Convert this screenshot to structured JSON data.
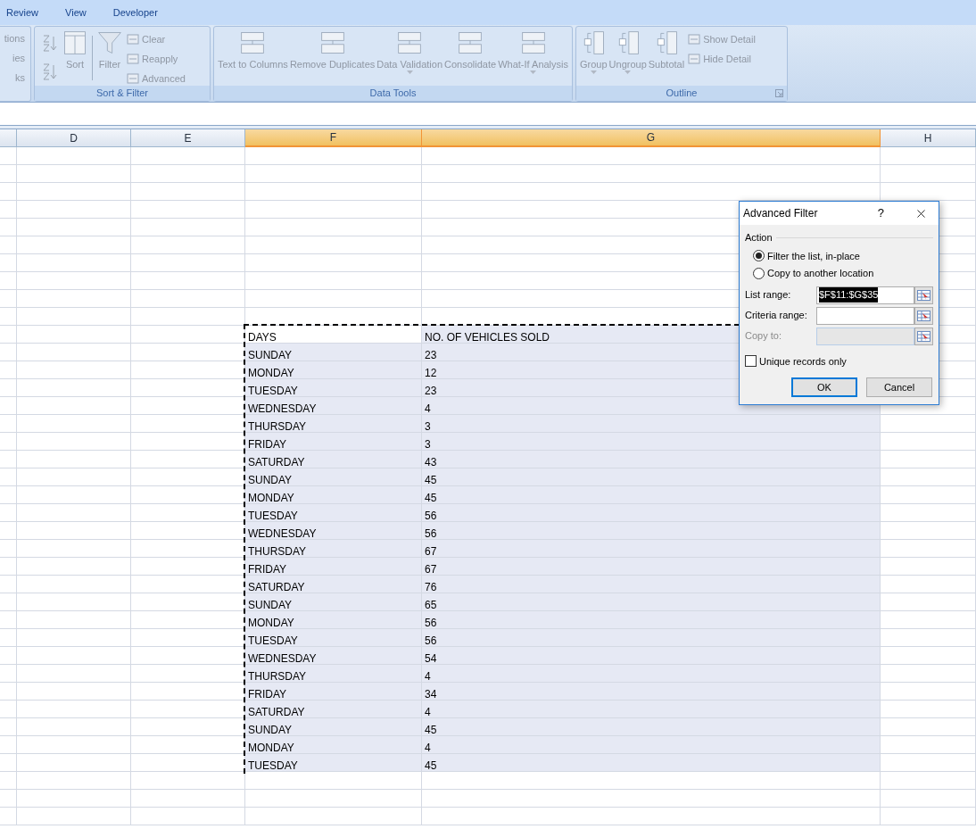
{
  "ribbon_tabs": [
    {
      "label": "Review"
    },
    {
      "label": "View"
    },
    {
      "label": "Developer"
    }
  ],
  "ribbon_groups": [
    {
      "kind": "partial",
      "buttons": [
        {
          "kind": "small",
          "label": "tions",
          "disabled": true
        },
        {
          "kind": "small",
          "label": "ies",
          "disabled": true
        },
        {
          "kind": "small",
          "label": "ks",
          "disabled": true
        }
      ]
    },
    {
      "kind": "sort_filter",
      "title": "Sort & Filter",
      "buttons": [
        {
          "kind": "sort_pair",
          "disabled": true
        },
        {
          "kind": "large",
          "label": "Sort",
          "disabled": true
        },
        {
          "kind": "large",
          "label": "Filter",
          "disabled": true
        },
        {
          "kind": "small_stack",
          "items": [
            {
              "label": "Clear",
              "disabled": true
            },
            {
              "label": "Reapply",
              "disabled": true
            },
            {
              "label": "Advanced",
              "disabled": true
            }
          ]
        }
      ]
    },
    {
      "kind": "data_tools",
      "title": "Data Tools",
      "buttons": [
        {
          "kind": "large",
          "label": "Text to Columns",
          "disabled": true
        },
        {
          "kind": "large",
          "label": "Remove Duplicates",
          "disabled": true
        },
        {
          "kind": "large",
          "label": "Data Validation",
          "dropdown": true,
          "disabled": true
        },
        {
          "kind": "large",
          "label": "Consolidate",
          "disabled": true
        },
        {
          "kind": "large",
          "label": "What-If Analysis",
          "dropdown": true,
          "disabled": true
        }
      ]
    },
    {
      "kind": "outline",
      "title": "Outline",
      "launcher": true,
      "buttons": [
        {
          "kind": "large",
          "label": "Group",
          "dropdown": true,
          "disabled": true
        },
        {
          "kind": "large",
          "label": "Ungroup",
          "dropdown": true,
          "disabled": true
        },
        {
          "kind": "large",
          "label": "Subtotal",
          "disabled": true
        },
        {
          "kind": "small_stack",
          "items": [
            {
              "label": "Show Detail",
              "disabled": true
            },
            {
              "label": "Hide Detail",
              "disabled": true
            }
          ]
        }
      ]
    }
  ],
  "columns": [
    {
      "selected": false
    },
    {
      "label": "D",
      "selected": false
    },
    {
      "label": "E",
      "selected": false
    },
    {
      "label": "F",
      "selected": true
    },
    {
      "label": "G",
      "selected": true
    },
    {
      "label": "H",
      "selected": false
    }
  ],
  "table": {
    "header": [
      "DAYS",
      "NO. OF VEHICLES SOLD"
    ],
    "range_selected": true,
    "rows": [
      [
        "SUNDAY",
        "23"
      ],
      [
        "MONDAY",
        "12"
      ],
      [
        "TUESDAY",
        "23"
      ],
      [
        "WEDNESDAY",
        "4"
      ],
      [
        "THURSDAY",
        "3"
      ],
      [
        "FRIDAY",
        "3"
      ],
      [
        "SATURDAY",
        "43"
      ],
      [
        "SUNDAY",
        "45"
      ],
      [
        "MONDAY",
        "45"
      ],
      [
        "TUESDAY",
        "56"
      ],
      [
        "WEDNESDAY",
        "56"
      ],
      [
        "THURSDAY",
        "67"
      ],
      [
        "FRIDAY",
        "67"
      ],
      [
        "SATURDAY",
        "76"
      ],
      [
        "SUNDAY",
        "65"
      ],
      [
        "MONDAY",
        "56"
      ],
      [
        "TUESDAY",
        "56"
      ],
      [
        "WEDNESDAY",
        "54"
      ],
      [
        "THURSDAY",
        "4"
      ],
      [
        "FRIDAY",
        "34"
      ],
      [
        "SATURDAY",
        "4"
      ],
      [
        "SUNDAY",
        "45"
      ],
      [
        "MONDAY",
        "4"
      ],
      [
        "TUESDAY",
        "45"
      ]
    ]
  },
  "dialog": {
    "title": "Advanced Filter",
    "help": "?",
    "section": "Action",
    "options": [
      {
        "label": "Filter the list, in-place",
        "selected": true
      },
      {
        "label": "Copy to another location",
        "selected": false
      }
    ],
    "fields": [
      {
        "label": "List range:",
        "value": "$F$11:$G$35",
        "highlighted": true,
        "disabled": false
      },
      {
        "label": "Criteria range:",
        "disabled": false
      },
      {
        "label": "Copy to:",
        "disabled": true
      }
    ],
    "unique": {
      "label": "Unique records only",
      "checked": false
    },
    "buttons": [
      {
        "label": "OK",
        "default": true
      },
      {
        "label": "Cancel",
        "default": false
      }
    ]
  }
}
